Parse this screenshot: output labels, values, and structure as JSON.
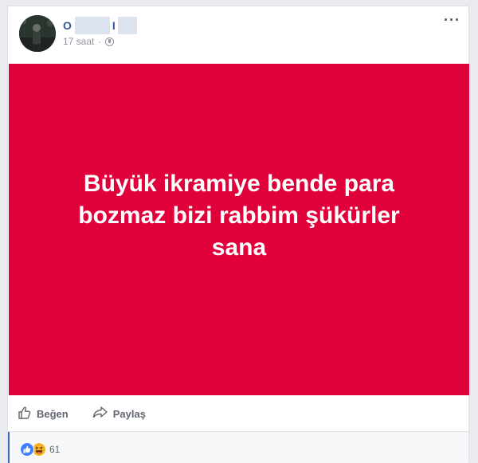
{
  "post": {
    "author": {
      "name_visible_start": "O",
      "name_visible_mid": "I"
    },
    "time": "17 saat",
    "separator": "·",
    "privacy_icon": "globe-icon",
    "more_icon": "more-options-icon",
    "text": "Büyük ikramiye bende para bozmaz bizi rabbim şükürler sana",
    "background_color": "#e0003a"
  },
  "actions": {
    "like_label": "Beğen",
    "share_label": "Paylaş"
  },
  "reactions": {
    "types": [
      "like",
      "haha"
    ],
    "count": "61"
  },
  "colors": {
    "link_blue": "#365899",
    "fb_blue": "#4267b2",
    "post_red": "#e0003a"
  }
}
